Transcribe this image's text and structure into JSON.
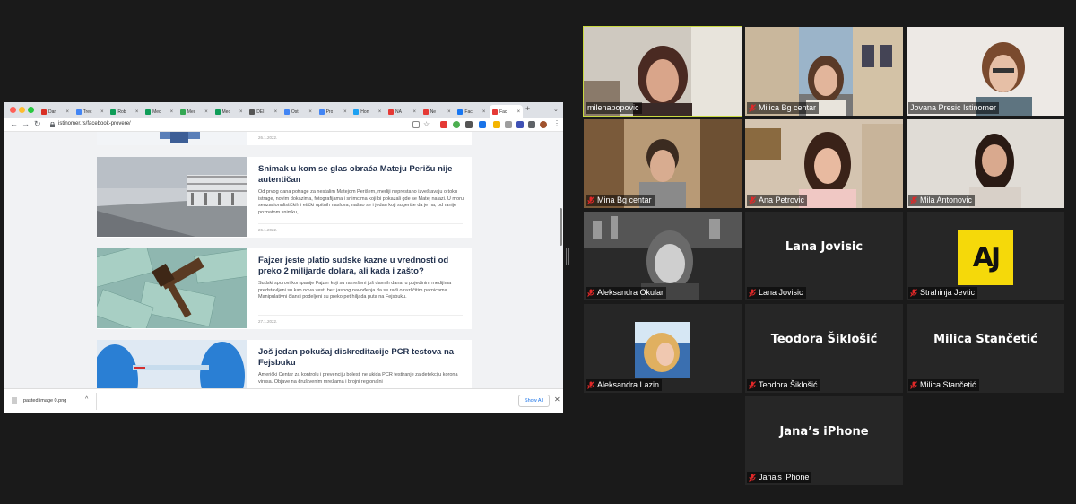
{
  "browser": {
    "tabs": [
      {
        "label": "Dan",
        "color": "#d93025"
      },
      {
        "label": "Trec",
        "color": "#4285f4"
      },
      {
        "label": "Rob",
        "color": "#0f9d58"
      },
      {
        "label": "Mec",
        "color": "#0f9d58"
      },
      {
        "label": "Mec",
        "color": "#34a853"
      },
      {
        "label": "Mec",
        "color": "#0f9d58"
      },
      {
        "label": "DEI",
        "color": "#555555"
      },
      {
        "label": "Ost",
        "color": "#4285f4"
      },
      {
        "label": "Pro",
        "color": "#4285f4"
      },
      {
        "label": "Hon",
        "color": "#1da1f2"
      },
      {
        "label": "NA",
        "color": "#e53935"
      },
      {
        "label": "Ne",
        "color": "#e53935"
      },
      {
        "label": "Fac",
        "color": "#1877f2"
      },
      {
        "label": "Fac",
        "color": "#e53935"
      }
    ],
    "url": "istinomer.rs/facebook-provere/",
    "articles": [
      {
        "title": "",
        "excerpt": "",
        "date": "26.1.2022."
      },
      {
        "title": "Snimak u kom se glas obraća Mateju Perišu nije autentičan",
        "excerpt": "Od prvog dana potrage za nestalim Matejom Perišem, mediji neprestano izveštavaju o toku istrage, novim dokazima, fotografijama i snimcima koji bi pokazali gde se Matej nalazi. U moru senzacionalističkih i etički upitnih naslova, našao se i jedan koji sugeriše da je na, od ranije poznatom snimku,",
        "date": "26.1.2022."
      },
      {
        "title": "Fajzer jeste platio sudske kazne u vrednosti od preko 2 milijarde dolara, ali kada i zašto?",
        "excerpt": "Sudski sporovi kompanije Fajzer koji su razrešeni još davnih dana, u pojedinim medijima predstavljeni su kao nova vest, bez jasnog navođenja da se radi o različitim parnicama. Manipulativni članci podeljeni su preko pet hiljada puta na Fejsbuku.",
        "date": "27.1.2022."
      },
      {
        "title": "Još jedan pokušaj diskreditacije PCR testova na Fejsbuku",
        "excerpt": "Američki Centar za kontrolu i prevenciju bolesti ne ukida PCR testiranje za detekciju korona virusa. Objave na društvenim mrežama i brojni regionalni",
        "date": ""
      }
    ],
    "download": {
      "filename": "pasted image 0.png",
      "show_all": "Show All"
    }
  },
  "participants": [
    {
      "name": "milenapopovic",
      "muted": false,
      "video": true,
      "speaking": true
    },
    {
      "name": "Milica Bg centar",
      "muted": true,
      "video": true
    },
    {
      "name": "Jovana Presic Istinomer",
      "muted": false,
      "video": true
    },
    {
      "name": "Mina Bg centar",
      "muted": true,
      "video": true
    },
    {
      "name": "Ana Petrovic",
      "muted": true,
      "video": true
    },
    {
      "name": "Mila Antonovic",
      "muted": true,
      "video": true
    },
    {
      "name": "Aleksandra Okular",
      "muted": true,
      "video": true
    },
    {
      "name": "Lana Jovisic",
      "muted": true,
      "video": false
    },
    {
      "name": "Strahinja Jevtic",
      "muted": true,
      "video": false,
      "avatar_text": "AJ"
    },
    {
      "name": "Aleksandra Lazin",
      "muted": true,
      "video": false
    },
    {
      "name": "Teodora Šiklošić",
      "muted": true,
      "video": false
    },
    {
      "name": "Milica Stančetić",
      "muted": true,
      "video": false
    },
    {
      "name": "Jana’s iPhone",
      "muted": true,
      "video": false
    }
  ],
  "colors": {
    "speaker_border": "#c9d941",
    "avatar_yellow": "#f5d90a",
    "title_navy": "#23324e"
  }
}
